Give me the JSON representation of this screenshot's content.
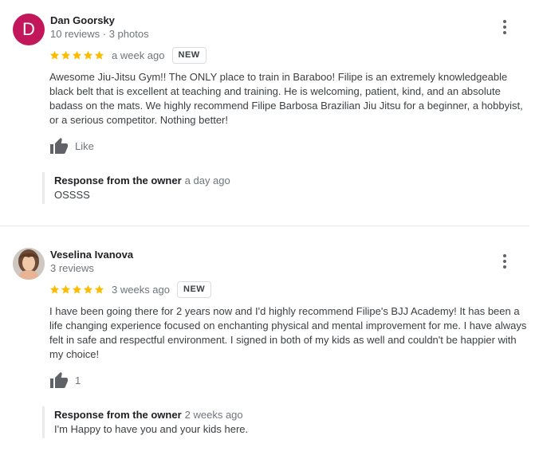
{
  "reviews": [
    {
      "avatar_letter": "D",
      "avatar_color": "#c2185b",
      "name": "Dan Goorsky",
      "meta": "10 reviews · 3 photos",
      "stars": 5,
      "time": "a week ago",
      "badge": "NEW",
      "text": "Awesome Jiu-Jitsu Gym!!  The ONLY place to train in Baraboo! Filipe is an extremely knowledgeable black belt that is excellent at teaching and training. He is welcoming, patient, kind, and an absolute badass on the mats. We highly recommend Filipe Barbosa Brazilian Jiu Jitsu for a beginner, a hobbyist, or a serious competitor. Nothing better!",
      "like_label": "Like",
      "response": {
        "title": "Response from the owner",
        "time": "a day ago",
        "text": "OSSSS"
      }
    },
    {
      "name": "Veselina Ivanova",
      "meta": "3 reviews",
      "stars": 5,
      "time": "3 weeks ago",
      "badge": "NEW",
      "text": "I have been going there for 2 years now and I'd highly recommend Filipe's BJJ Academy! It has been a life changing experience focused on enchanting physical and mental improvement for me. I have always felt in safe and respectful environment. I signed in both of my kids as well and couldn't be happier with my choice!",
      "like_label": "1",
      "response": {
        "title": "Response from the owner",
        "time": "2 weeks ago",
        "text": "I'm Happy to have you and your kids here."
      }
    }
  ],
  "colors": {
    "star": "#fbbc04",
    "thumb": "#5f6368"
  }
}
